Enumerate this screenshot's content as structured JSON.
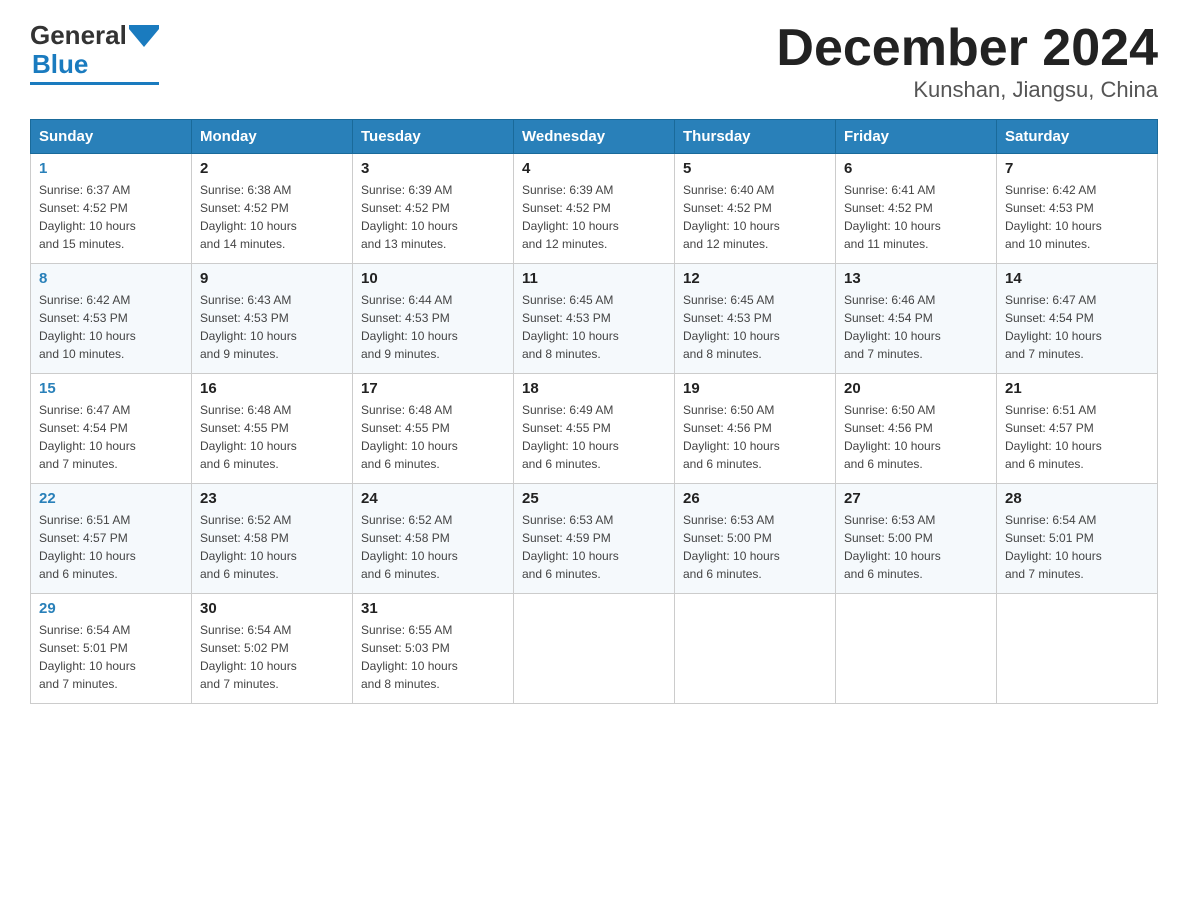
{
  "header": {
    "title": "December 2024",
    "subtitle": "Kunshan, Jiangsu, China",
    "logo_general": "General",
    "logo_blue": "Blue"
  },
  "columns": [
    "Sunday",
    "Monday",
    "Tuesday",
    "Wednesday",
    "Thursday",
    "Friday",
    "Saturday"
  ],
  "weeks": [
    [
      {
        "day": "1",
        "sunrise": "6:37 AM",
        "sunset": "4:52 PM",
        "daylight": "10 hours and 15 minutes."
      },
      {
        "day": "2",
        "sunrise": "6:38 AM",
        "sunset": "4:52 PM",
        "daylight": "10 hours and 14 minutes."
      },
      {
        "day": "3",
        "sunrise": "6:39 AM",
        "sunset": "4:52 PM",
        "daylight": "10 hours and 13 minutes."
      },
      {
        "day": "4",
        "sunrise": "6:39 AM",
        "sunset": "4:52 PM",
        "daylight": "10 hours and 12 minutes."
      },
      {
        "day": "5",
        "sunrise": "6:40 AM",
        "sunset": "4:52 PM",
        "daylight": "10 hours and 12 minutes."
      },
      {
        "day": "6",
        "sunrise": "6:41 AM",
        "sunset": "4:52 PM",
        "daylight": "10 hours and 11 minutes."
      },
      {
        "day": "7",
        "sunrise": "6:42 AM",
        "sunset": "4:53 PM",
        "daylight": "10 hours and 10 minutes."
      }
    ],
    [
      {
        "day": "8",
        "sunrise": "6:42 AM",
        "sunset": "4:53 PM",
        "daylight": "10 hours and 10 minutes."
      },
      {
        "day": "9",
        "sunrise": "6:43 AM",
        "sunset": "4:53 PM",
        "daylight": "10 hours and 9 minutes."
      },
      {
        "day": "10",
        "sunrise": "6:44 AM",
        "sunset": "4:53 PM",
        "daylight": "10 hours and 9 minutes."
      },
      {
        "day": "11",
        "sunrise": "6:45 AM",
        "sunset": "4:53 PM",
        "daylight": "10 hours and 8 minutes."
      },
      {
        "day": "12",
        "sunrise": "6:45 AM",
        "sunset": "4:53 PM",
        "daylight": "10 hours and 8 minutes."
      },
      {
        "day": "13",
        "sunrise": "6:46 AM",
        "sunset": "4:54 PM",
        "daylight": "10 hours and 7 minutes."
      },
      {
        "day": "14",
        "sunrise": "6:47 AM",
        "sunset": "4:54 PM",
        "daylight": "10 hours and 7 minutes."
      }
    ],
    [
      {
        "day": "15",
        "sunrise": "6:47 AM",
        "sunset": "4:54 PM",
        "daylight": "10 hours and 7 minutes."
      },
      {
        "day": "16",
        "sunrise": "6:48 AM",
        "sunset": "4:55 PM",
        "daylight": "10 hours and 6 minutes."
      },
      {
        "day": "17",
        "sunrise": "6:48 AM",
        "sunset": "4:55 PM",
        "daylight": "10 hours and 6 minutes."
      },
      {
        "day": "18",
        "sunrise": "6:49 AM",
        "sunset": "4:55 PM",
        "daylight": "10 hours and 6 minutes."
      },
      {
        "day": "19",
        "sunrise": "6:50 AM",
        "sunset": "4:56 PM",
        "daylight": "10 hours and 6 minutes."
      },
      {
        "day": "20",
        "sunrise": "6:50 AM",
        "sunset": "4:56 PM",
        "daylight": "10 hours and 6 minutes."
      },
      {
        "day": "21",
        "sunrise": "6:51 AM",
        "sunset": "4:57 PM",
        "daylight": "10 hours and 6 minutes."
      }
    ],
    [
      {
        "day": "22",
        "sunrise": "6:51 AM",
        "sunset": "4:57 PM",
        "daylight": "10 hours and 6 minutes."
      },
      {
        "day": "23",
        "sunrise": "6:52 AM",
        "sunset": "4:58 PM",
        "daylight": "10 hours and 6 minutes."
      },
      {
        "day": "24",
        "sunrise": "6:52 AM",
        "sunset": "4:58 PM",
        "daylight": "10 hours and 6 minutes."
      },
      {
        "day": "25",
        "sunrise": "6:53 AM",
        "sunset": "4:59 PM",
        "daylight": "10 hours and 6 minutes."
      },
      {
        "day": "26",
        "sunrise": "6:53 AM",
        "sunset": "5:00 PM",
        "daylight": "10 hours and 6 minutes."
      },
      {
        "day": "27",
        "sunrise": "6:53 AM",
        "sunset": "5:00 PM",
        "daylight": "10 hours and 6 minutes."
      },
      {
        "day": "28",
        "sunrise": "6:54 AM",
        "sunset": "5:01 PM",
        "daylight": "10 hours and 7 minutes."
      }
    ],
    [
      {
        "day": "29",
        "sunrise": "6:54 AM",
        "sunset": "5:01 PM",
        "daylight": "10 hours and 7 minutes."
      },
      {
        "day": "30",
        "sunrise": "6:54 AM",
        "sunset": "5:02 PM",
        "daylight": "10 hours and 7 minutes."
      },
      {
        "day": "31",
        "sunrise": "6:55 AM",
        "sunset": "5:03 PM",
        "daylight": "10 hours and 8 minutes."
      },
      null,
      null,
      null,
      null
    ]
  ],
  "labels": {
    "sunrise": "Sunrise:",
    "sunset": "Sunset:",
    "daylight": "Daylight:"
  }
}
